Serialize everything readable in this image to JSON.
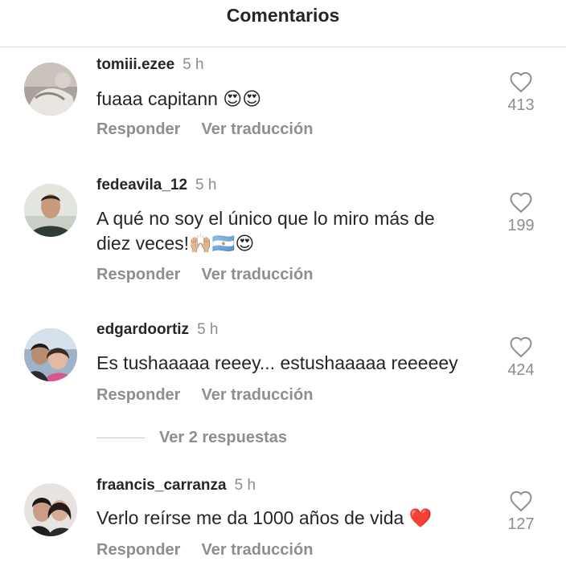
{
  "header": {
    "title": "Comentarios"
  },
  "comments": [
    {
      "username": "tomiii.ezee",
      "time": "5 h",
      "text_lines": [
        "fuaaa capitann 😍😍"
      ],
      "reply_label": "Responder",
      "translate_label": "Ver traducción",
      "likes": "413"
    },
    {
      "username": "fedeavila_12",
      "time": "5 h",
      "text_lines": [
        "A qué no soy el único que lo miro más de",
        "diez veces!🙌🏼🇦🇷😍"
      ],
      "reply_label": "Responder",
      "translate_label": "Ver traducción",
      "likes": "199"
    },
    {
      "username": "edgardoortiz",
      "time": "5 h",
      "text_lines": [
        "Es tushaaaaa reeey... estushaaaaa reeeeey"
      ],
      "reply_label": "Responder",
      "translate_label": "Ver traducción",
      "likes": "424",
      "view_replies": "Ver 2 respuestas"
    },
    {
      "username": "fraancis_carranza",
      "time": "5 h",
      "text_lines": [
        "Verlo reírse me da 1000 años de vida ❤️"
      ],
      "reply_label": "Responder",
      "translate_label": "Ver traducción",
      "likes": "127"
    }
  ],
  "colors": {
    "text": "#262626",
    "secondary": "#8e8e8e",
    "divider": "#dbdbdb"
  },
  "icons": {
    "like": "heart-outline-icon"
  }
}
